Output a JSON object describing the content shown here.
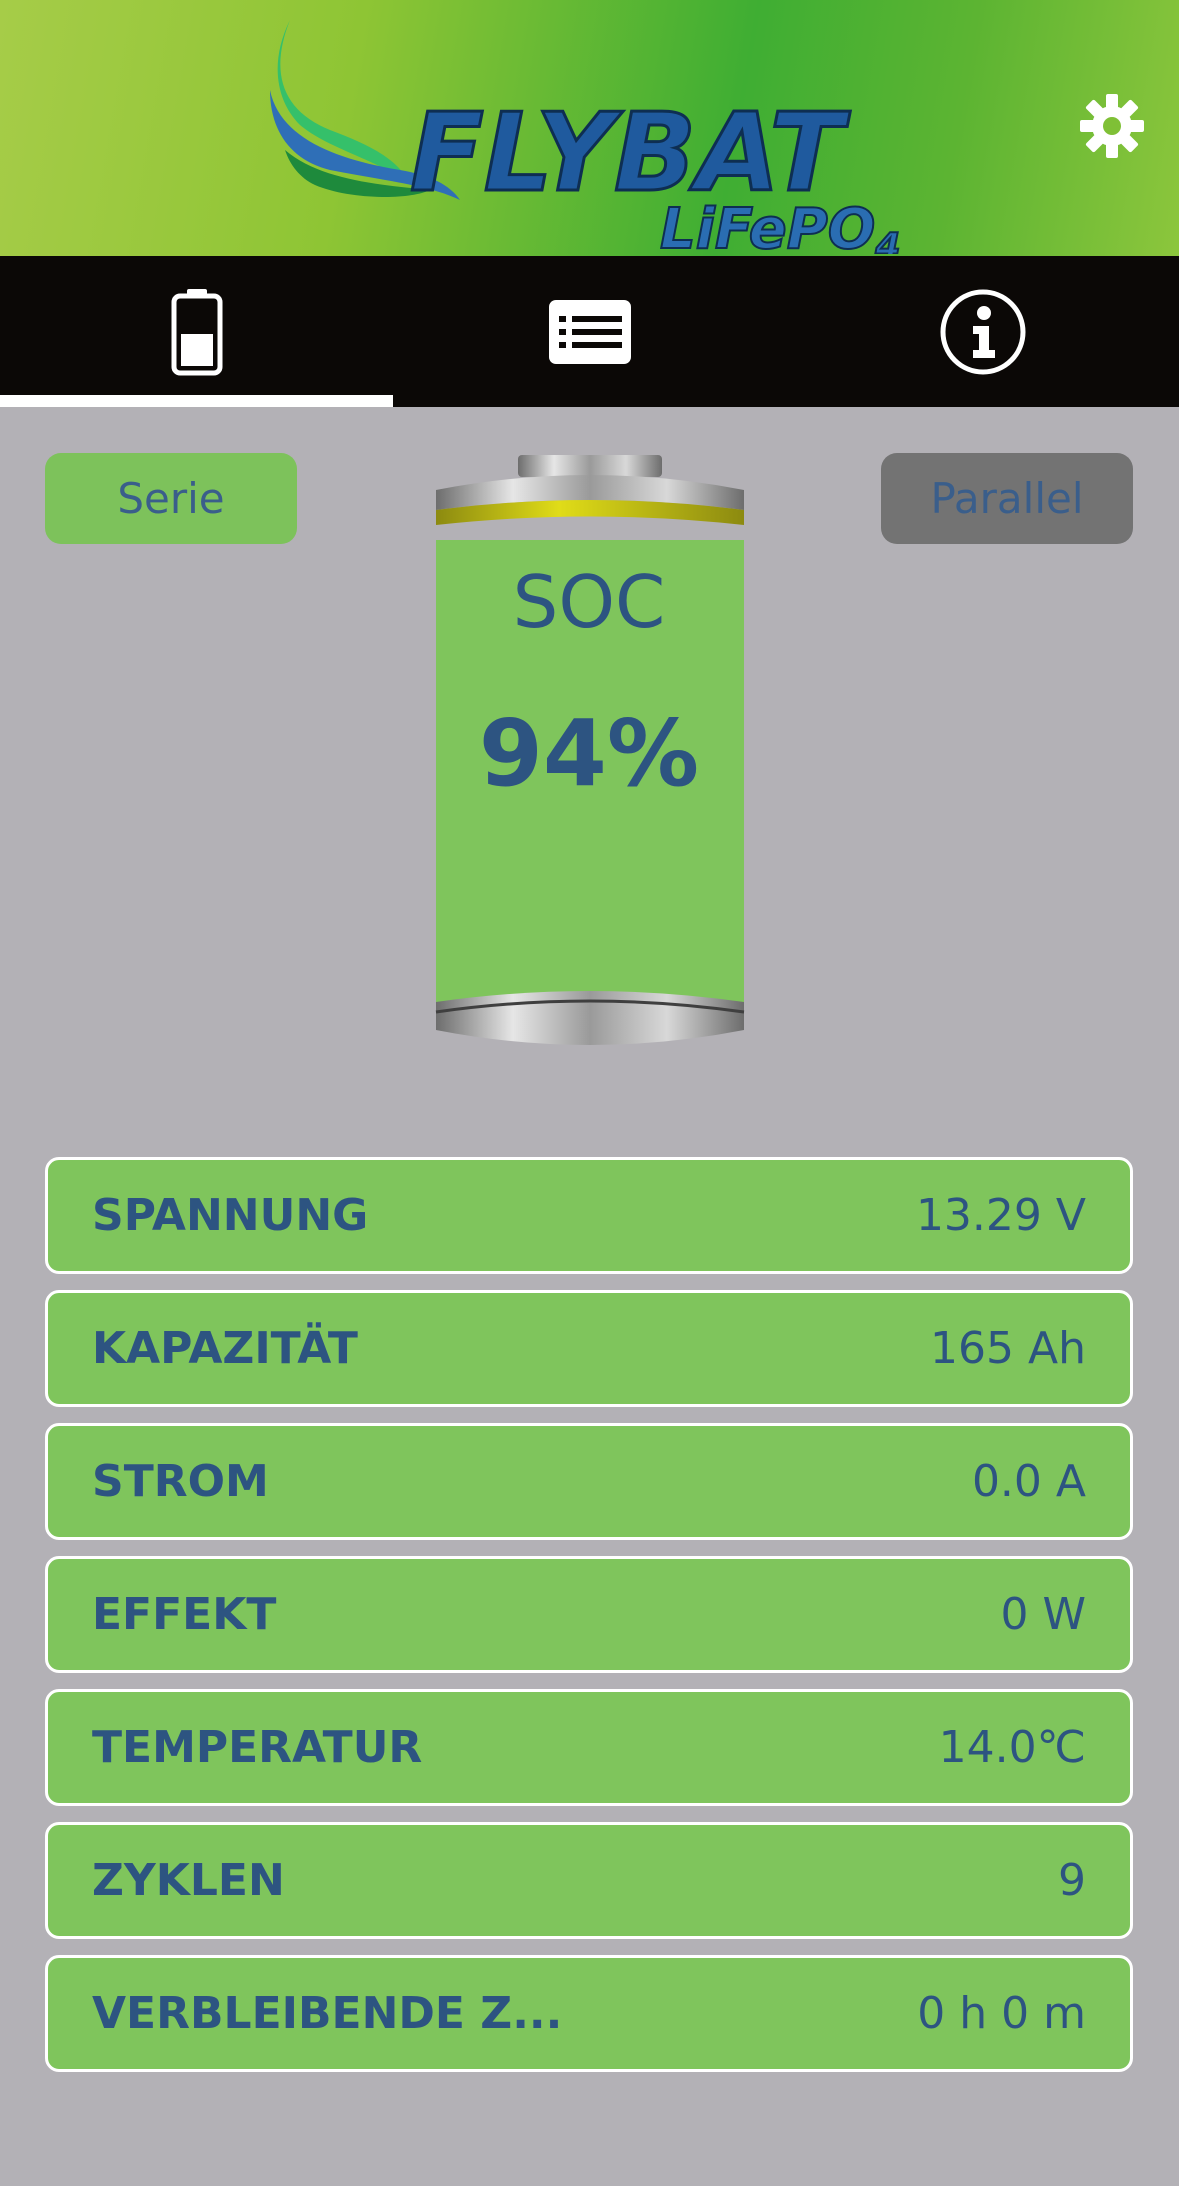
{
  "app": {
    "logo_name": "FLYBAT",
    "logo_sub": "LiFePO",
    "logo_sub_index": "4"
  },
  "header": {
    "settings_icon": "gear-icon"
  },
  "tabs": [
    {
      "icon": "battery-icon",
      "active": true
    },
    {
      "icon": "list-icon",
      "active": false
    },
    {
      "icon": "info-icon",
      "active": false
    }
  ],
  "modes": {
    "serie_label": "Serie",
    "parallel_label": "Parallel",
    "selected": "Serie"
  },
  "battery": {
    "soc_label": "SOC",
    "soc_value": "94%",
    "soc_fraction": 0.94
  },
  "stats": [
    {
      "label": "SPANNUNG",
      "value": "13.29 V"
    },
    {
      "label": "KAPAZITÄT",
      "value": "165 Ah"
    },
    {
      "label": "STROM",
      "value": "0.0 A"
    },
    {
      "label": "EFFEKT",
      "value": "0 W"
    },
    {
      "label": "TEMPERATUR",
      "value": "14.0℃"
    },
    {
      "label": "ZYKLEN",
      "value": "9"
    },
    {
      "label": "VERBLEIBENDE Z...",
      "value": "0 h 0 m"
    }
  ],
  "colors": {
    "header_green": "#6cbb3c",
    "tabbar": "#0b0806",
    "row_green": "#7fc55c",
    "text_blue": "#2d5481",
    "background": "#b3b1b6"
  }
}
